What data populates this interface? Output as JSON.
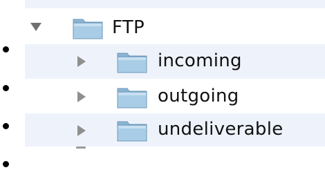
{
  "tree": {
    "root": {
      "label": "FTP",
      "expanded": true,
      "icon": "folder-icon"
    },
    "children": [
      {
        "label": "incoming",
        "expanded": false,
        "icon": "folder-icon"
      },
      {
        "label": "outgoing",
        "expanded": false,
        "icon": "folder-icon"
      },
      {
        "label": "undeliverable",
        "expanded": false,
        "icon": "folder-icon"
      }
    ]
  },
  "colors": {
    "alt_row": "#eef3fb",
    "folder_front": "#9ec4df",
    "folder_tab": "#8cb5d4",
    "disclosure": "#8f8f8f"
  }
}
